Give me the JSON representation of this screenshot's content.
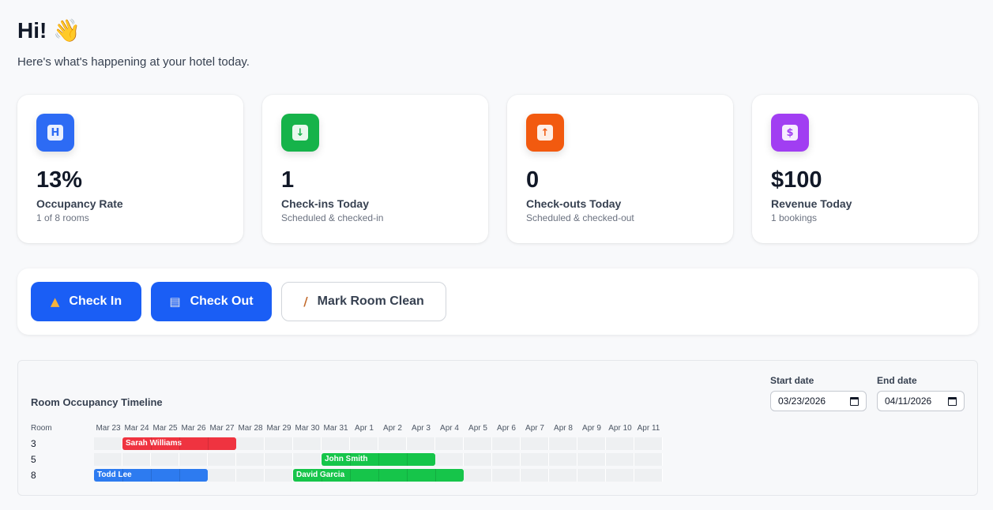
{
  "greeting": {
    "title": "Hi!",
    "emoji": "👋",
    "subtitle": "Here's what's happening at your hotel today."
  },
  "stats": [
    {
      "icon": "hotel-icon",
      "glyph": "H",
      "color": "#2d6bf4",
      "value": "13%",
      "label": "Occupancy Rate",
      "sub": "1 of 8 rooms"
    },
    {
      "icon": "inbox-in-icon",
      "glyph": "↓",
      "color": "#16b34a",
      "value": "1",
      "label": "Check-ins Today",
      "sub": "Scheduled & checked-in"
    },
    {
      "icon": "inbox-out-icon",
      "glyph": "↑",
      "color": "#f25a0f",
      "value": "0",
      "label": "Check-outs Today",
      "sub": "Scheduled & checked-out"
    },
    {
      "icon": "money-bag-icon",
      "glyph": "$",
      "color": "#a13ef2",
      "value": "$100",
      "label": "Revenue Today",
      "sub": "1 bookings"
    }
  ],
  "actions": {
    "check_in": "Check In",
    "check_out": "Check Out",
    "mark_clean": "Mark Room Clean"
  },
  "timeline": {
    "title": "Room Occupancy Timeline",
    "start_label": "Start date",
    "start_value": "03/23/2026",
    "end_label": "End date",
    "end_value": "04/11/2026",
    "room_header": "Room",
    "dates": [
      "Mar 23",
      "Mar 24",
      "Mar 25",
      "Mar 26",
      "Mar 27",
      "Mar 28",
      "Mar 29",
      "Mar 30",
      "Mar 31",
      "Apr 1",
      "Apr 2",
      "Apr 3",
      "Apr 4",
      "Apr 5",
      "Apr 6",
      "Apr 7",
      "Apr 8",
      "Apr 9",
      "Apr 10",
      "Apr 11"
    ],
    "rooms": [
      {
        "room": "3",
        "bookings": [
          {
            "guest": "Sarah Williams",
            "start_index": 1,
            "days": 4,
            "color": "#ef3340"
          }
        ]
      },
      {
        "room": "5",
        "bookings": [
          {
            "guest": "John Smith",
            "start_index": 8,
            "days": 4,
            "color": "#16c54a"
          }
        ]
      },
      {
        "room": "8",
        "bookings": [
          {
            "guest": "Todd Lee",
            "start_index": 0,
            "days": 4,
            "color": "#2d7bf0"
          },
          {
            "guest": "David Garcia",
            "start_index": 7,
            "days": 6,
            "color": "#16c54a"
          }
        ]
      }
    ]
  }
}
